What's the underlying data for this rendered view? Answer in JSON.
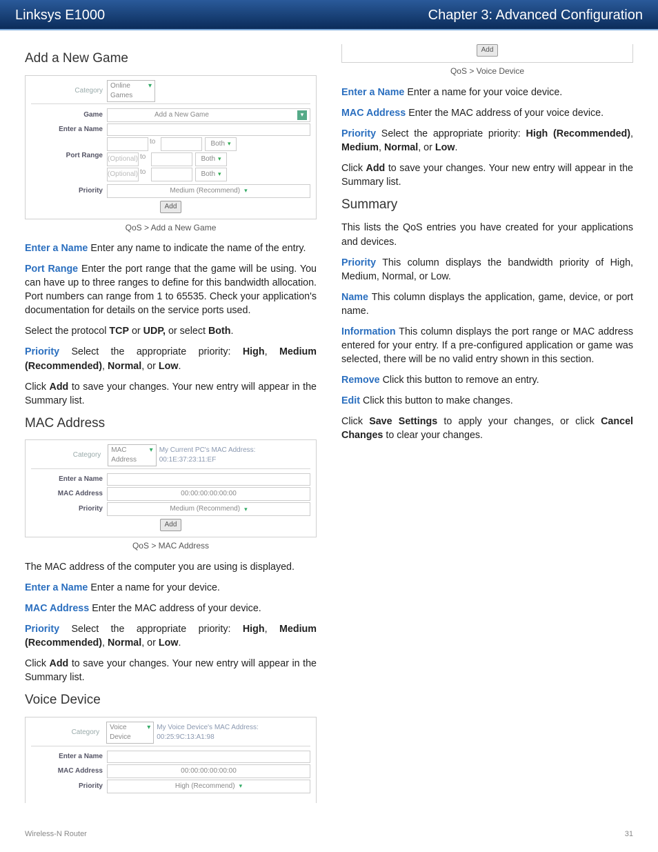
{
  "header": {
    "left": "Linksys E1000",
    "right": "Chapter 3: Advanced Configuration"
  },
  "sections": {
    "addGame": {
      "title": "Add a New Game",
      "caption": "QoS > Add a New Game",
      "fig": {
        "category": "Category",
        "catVal": "Online Games",
        "game": "Game",
        "gameVal": "Add a New Game",
        "ename": "Enter a Name",
        "prange": "Port Range",
        "optional": "(Optional)",
        "to": "to",
        "both": "Both",
        "priority": "Priority",
        "priVal": "Medium (Recommend)",
        "add": "Add"
      }
    },
    "mac": {
      "title": "MAC Address",
      "caption": "QoS > MAC Address",
      "fig": {
        "category": "Category",
        "catVal": "MAC Address",
        "curLabel": "My Current PC's MAC Address:",
        "curVal": "00:1E:37:23:11:EF",
        "ename": "Enter a Name",
        "maddr": "MAC Address",
        "maddrVal": "00:00:00:00:00:00",
        "priority": "Priority",
        "priVal": "Medium (Recommend)",
        "add": "Add"
      }
    },
    "voice": {
      "title": "Voice Device",
      "caption": "QoS > Voice Device",
      "fig": {
        "category": "Category",
        "catVal": "Voice Device",
        "curLabel": "My Voice Device's MAC Address:",
        "curVal": "00:25:9C:13:A1:98",
        "ename": "Enter a Name",
        "maddr": "MAC Address",
        "maddrVal": "00:00:00:00:00:00",
        "priority": "Priority",
        "priVal": "High (Recommend)",
        "add": "Add"
      }
    },
    "summary": {
      "title": "Summary"
    }
  },
  "text": {
    "p1a": "Enter a Name",
    "p1b": "  Enter any name to indicate the name of the entry.",
    "p2a": "Port Range",
    "p2b": "  Enter the port range that the game will be using. You can have up to three ranges to define for this bandwidth allocation. Port numbers can range from 1 to 65535. Check your application's documentation for details on the service ports used.",
    "p3a": "Select the protocol ",
    "p3b": "TCP",
    "p3c": " or ",
    "p3d": "UDP,",
    "p3e": " or select ",
    "p3f": "Both",
    "p3g": ".",
    "p4a": "Priority",
    "p4b": "  Select the appropriate priority: ",
    "p4c": "High",
    "p4d": ", ",
    "p4e": "Medium (Recommended)",
    "p4f": ", ",
    "p4g": "Normal",
    "p4h": ", or ",
    "p4i": "Low",
    "p4j": ".",
    "p5a": "Click ",
    "p5b": "Add",
    "p5c": " to save your changes. Your new entry will appear in the Summary list.",
    "p6": "The MAC address of the computer you are using is displayed.",
    "p7a": "Enter a Name",
    "p7b": "  Enter a name for your device.",
    "p8a": "MAC Address",
    "p8b": "  Enter the MAC address of your device.",
    "p9a": "Enter a Name",
    "p9b": "  Enter a name for your voice device.",
    "r1a": "MAC Address",
    "r1b": " Enter the MAC address of your voice device.",
    "r2a": "Priority",
    "r2b": " Select the appropriate priority: ",
    "r2c": "High (Recommended)",
    "r2d": ", ",
    "r2e": "Medium",
    "r2f": ", ",
    "r2g": "Normal",
    "r2h": ", or ",
    "r2i": "Low",
    "r2j": ".",
    "r3a": "Click ",
    "r3b": "Add",
    "r3c": " to save your changes. Your new entry will appear in the Summary list.",
    "r4": "This lists the QoS entries you have created for your applications and devices.",
    "r5a": "Priority",
    "r5b": "  This column displays the bandwidth priority of High, Medium, Normal, or Low.",
    "r6a": "Name",
    "r6b": " This column displays the application, game, device, or port name.",
    "r7a": "Information",
    "r7b": " This column displays the port range or MAC address entered for your entry. If a pre-configured application or game was selected, there will be no valid entry shown in this section.",
    "r8a": "Remove",
    "r8b": "  Click this button to remove an entry.",
    "r9a": "Edit",
    "r9b": "  Click this button to make changes.",
    "r10a": "Click ",
    "r10b": "Save Settings",
    "r10c": " to apply your changes, or click ",
    "r10d": "Cancel Changes",
    "r10e": " to clear your changes."
  },
  "footer": {
    "left": "Wireless-N Router",
    "right": "31"
  }
}
